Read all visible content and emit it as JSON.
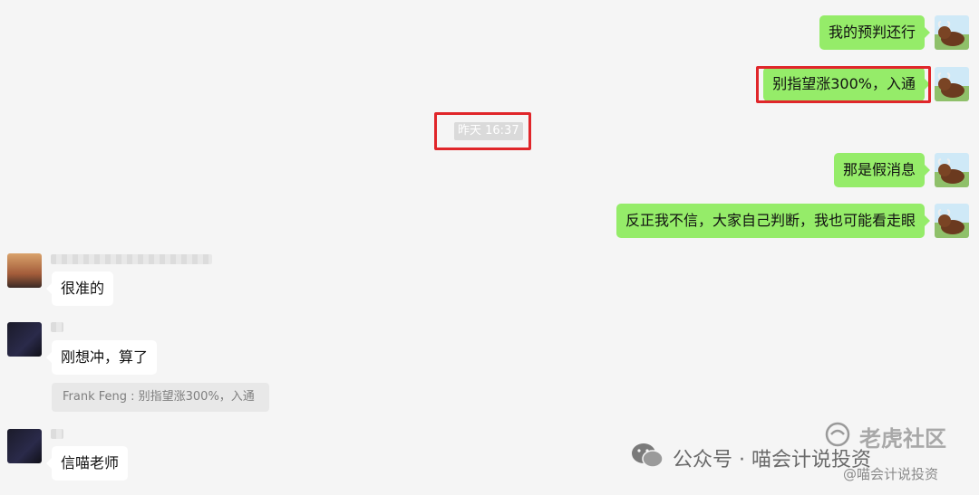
{
  "messages_sent": [
    "我的预判还行",
    "别指望涨300%，入通",
    "那是假消息",
    "反正我不信，大家自己判断，我也可能看走眼"
  ],
  "timestamp": "昨天 16:37",
  "messages_received": [
    "很准的",
    "刚想冲，算了",
    "信喵老师"
  ],
  "quoted_reply": "Frank Feng : 别指望涨300%，入通",
  "watermark": {
    "account": "公众号 · 喵会计说投资",
    "community": "老虎社区",
    "handle": "@喵会计说投资"
  },
  "colors": {
    "sent_bubble": "#95ec69",
    "received_bubble": "#ffffff",
    "highlight_box": "#e0262a",
    "background": "#f5f5f5"
  }
}
